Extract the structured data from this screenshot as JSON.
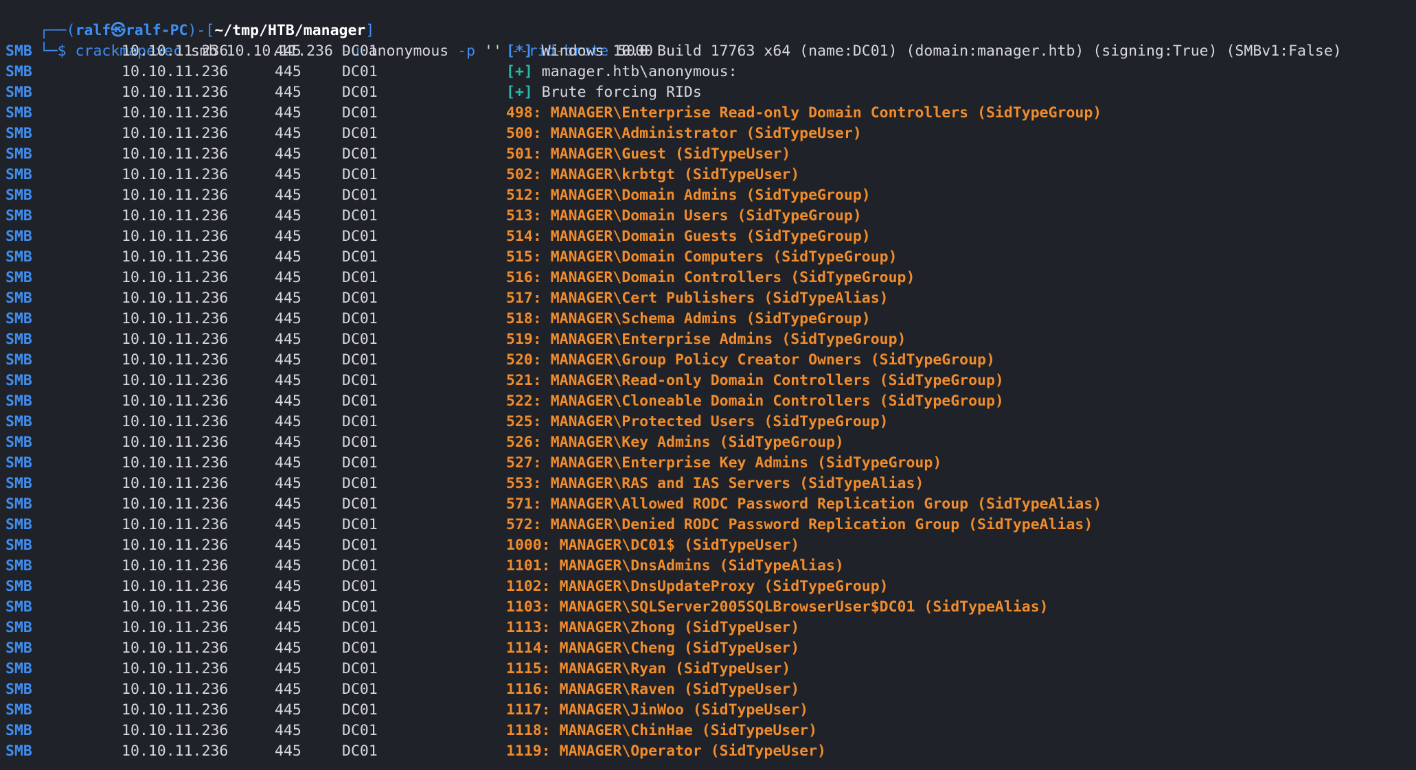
{
  "prompt": {
    "frame_top_left": "┌──(",
    "user": "ralf",
    "at_symbol": "㉿",
    "host": "ralf-PC",
    "frame_mid": ")-[",
    "cwd": "~/tmp/HTB/manager",
    "frame_end": "]",
    "frame_bottom": "└─$ ",
    "command": "crackmapexec",
    "arg1": " smb 10.10.11.236 ",
    "opt_u": "-u",
    "arg_u": " anonymous ",
    "opt_p": "-p",
    "arg_p": " '' ",
    "opt_rid": "--rid-brute",
    "arg_rid": " 5000"
  },
  "header_rows": [
    {
      "proto": "SMB",
      "ip": "10.10.11.236",
      "port": "445",
      "host": "DC01",
      "tag": "[*]",
      "text": " Windows 10.0 Build 17763 x64 (name:DC01) (domain:manager.htb) (signing:True) (SMBv1:False)"
    },
    {
      "proto": "SMB",
      "ip": "10.10.11.236",
      "port": "445",
      "host": "DC01",
      "tag": "[+]",
      "text": " manager.htb\\anonymous:"
    },
    {
      "proto": "SMB",
      "ip": "10.10.11.236",
      "port": "445",
      "host": "DC01",
      "tag": "[+]",
      "text": " Brute forcing RIDs"
    }
  ],
  "rid_rows": [
    {
      "proto": "SMB",
      "ip": "10.10.11.236",
      "port": "445",
      "host": "DC01",
      "text": "498: MANAGER\\Enterprise Read-only Domain Controllers (SidTypeGroup)"
    },
    {
      "proto": "SMB",
      "ip": "10.10.11.236",
      "port": "445",
      "host": "DC01",
      "text": "500: MANAGER\\Administrator (SidTypeUser)"
    },
    {
      "proto": "SMB",
      "ip": "10.10.11.236",
      "port": "445",
      "host": "DC01",
      "text": "501: MANAGER\\Guest (SidTypeUser)"
    },
    {
      "proto": "SMB",
      "ip": "10.10.11.236",
      "port": "445",
      "host": "DC01",
      "text": "502: MANAGER\\krbtgt (SidTypeUser)"
    },
    {
      "proto": "SMB",
      "ip": "10.10.11.236",
      "port": "445",
      "host": "DC01",
      "text": "512: MANAGER\\Domain Admins (SidTypeGroup)"
    },
    {
      "proto": "SMB",
      "ip": "10.10.11.236",
      "port": "445",
      "host": "DC01",
      "text": "513: MANAGER\\Domain Users (SidTypeGroup)"
    },
    {
      "proto": "SMB",
      "ip": "10.10.11.236",
      "port": "445",
      "host": "DC01",
      "text": "514: MANAGER\\Domain Guests (SidTypeGroup)"
    },
    {
      "proto": "SMB",
      "ip": "10.10.11.236",
      "port": "445",
      "host": "DC01",
      "text": "515: MANAGER\\Domain Computers (SidTypeGroup)"
    },
    {
      "proto": "SMB",
      "ip": "10.10.11.236",
      "port": "445",
      "host": "DC01",
      "text": "516: MANAGER\\Domain Controllers (SidTypeGroup)"
    },
    {
      "proto": "SMB",
      "ip": "10.10.11.236",
      "port": "445",
      "host": "DC01",
      "text": "517: MANAGER\\Cert Publishers (SidTypeAlias)"
    },
    {
      "proto": "SMB",
      "ip": "10.10.11.236",
      "port": "445",
      "host": "DC01",
      "text": "518: MANAGER\\Schema Admins (SidTypeGroup)"
    },
    {
      "proto": "SMB",
      "ip": "10.10.11.236",
      "port": "445",
      "host": "DC01",
      "text": "519: MANAGER\\Enterprise Admins (SidTypeGroup)"
    },
    {
      "proto": "SMB",
      "ip": "10.10.11.236",
      "port": "445",
      "host": "DC01",
      "text": "520: MANAGER\\Group Policy Creator Owners (SidTypeGroup)"
    },
    {
      "proto": "SMB",
      "ip": "10.10.11.236",
      "port": "445",
      "host": "DC01",
      "text": "521: MANAGER\\Read-only Domain Controllers (SidTypeGroup)"
    },
    {
      "proto": "SMB",
      "ip": "10.10.11.236",
      "port": "445",
      "host": "DC01",
      "text": "522: MANAGER\\Cloneable Domain Controllers (SidTypeGroup)"
    },
    {
      "proto": "SMB",
      "ip": "10.10.11.236",
      "port": "445",
      "host": "DC01",
      "text": "525: MANAGER\\Protected Users (SidTypeGroup)"
    },
    {
      "proto": "SMB",
      "ip": "10.10.11.236",
      "port": "445",
      "host": "DC01",
      "text": "526: MANAGER\\Key Admins (SidTypeGroup)"
    },
    {
      "proto": "SMB",
      "ip": "10.10.11.236",
      "port": "445",
      "host": "DC01",
      "text": "527: MANAGER\\Enterprise Key Admins (SidTypeGroup)"
    },
    {
      "proto": "SMB",
      "ip": "10.10.11.236",
      "port": "445",
      "host": "DC01",
      "text": "553: MANAGER\\RAS and IAS Servers (SidTypeAlias)"
    },
    {
      "proto": "SMB",
      "ip": "10.10.11.236",
      "port": "445",
      "host": "DC01",
      "text": "571: MANAGER\\Allowed RODC Password Replication Group (SidTypeAlias)"
    },
    {
      "proto": "SMB",
      "ip": "10.10.11.236",
      "port": "445",
      "host": "DC01",
      "text": "572: MANAGER\\Denied RODC Password Replication Group (SidTypeAlias)"
    },
    {
      "proto": "SMB",
      "ip": "10.10.11.236",
      "port": "445",
      "host": "DC01",
      "text": "1000: MANAGER\\DC01$ (SidTypeUser)"
    },
    {
      "proto": "SMB",
      "ip": "10.10.11.236",
      "port": "445",
      "host": "DC01",
      "text": "1101: MANAGER\\DnsAdmins (SidTypeAlias)"
    },
    {
      "proto": "SMB",
      "ip": "10.10.11.236",
      "port": "445",
      "host": "DC01",
      "text": "1102: MANAGER\\DnsUpdateProxy (SidTypeGroup)"
    },
    {
      "proto": "SMB",
      "ip": "10.10.11.236",
      "port": "445",
      "host": "DC01",
      "text": "1103: MANAGER\\SQLServer2005SQLBrowserUser$DC01 (SidTypeAlias)"
    },
    {
      "proto": "SMB",
      "ip": "10.10.11.236",
      "port": "445",
      "host": "DC01",
      "text": "1113: MANAGER\\Zhong (SidTypeUser)"
    },
    {
      "proto": "SMB",
      "ip": "10.10.11.236",
      "port": "445",
      "host": "DC01",
      "text": "1114: MANAGER\\Cheng (SidTypeUser)"
    },
    {
      "proto": "SMB",
      "ip": "10.10.11.236",
      "port": "445",
      "host": "DC01",
      "text": "1115: MANAGER\\Ryan (SidTypeUser)"
    },
    {
      "proto": "SMB",
      "ip": "10.10.11.236",
      "port": "445",
      "host": "DC01",
      "text": "1116: MANAGER\\Raven (SidTypeUser)"
    },
    {
      "proto": "SMB",
      "ip": "10.10.11.236",
      "port": "445",
      "host": "DC01",
      "text": "1117: MANAGER\\JinWoo (SidTypeUser)"
    },
    {
      "proto": "SMB",
      "ip": "10.10.11.236",
      "port": "445",
      "host": "DC01",
      "text": "1118: MANAGER\\ChinHae (SidTypeUser)"
    },
    {
      "proto": "SMB",
      "ip": "10.10.11.236",
      "port": "445",
      "host": "DC01",
      "text": "1119: MANAGER\\Operator (SidTypeUser)"
    }
  ],
  "colors": {
    "background": "#1f2229",
    "proto": "#3f8ef2",
    "tag_info": "#3f8ef2",
    "tag_plus": "#28b8a8",
    "rid_result": "#f08c2c",
    "text": "#d6d8de"
  }
}
